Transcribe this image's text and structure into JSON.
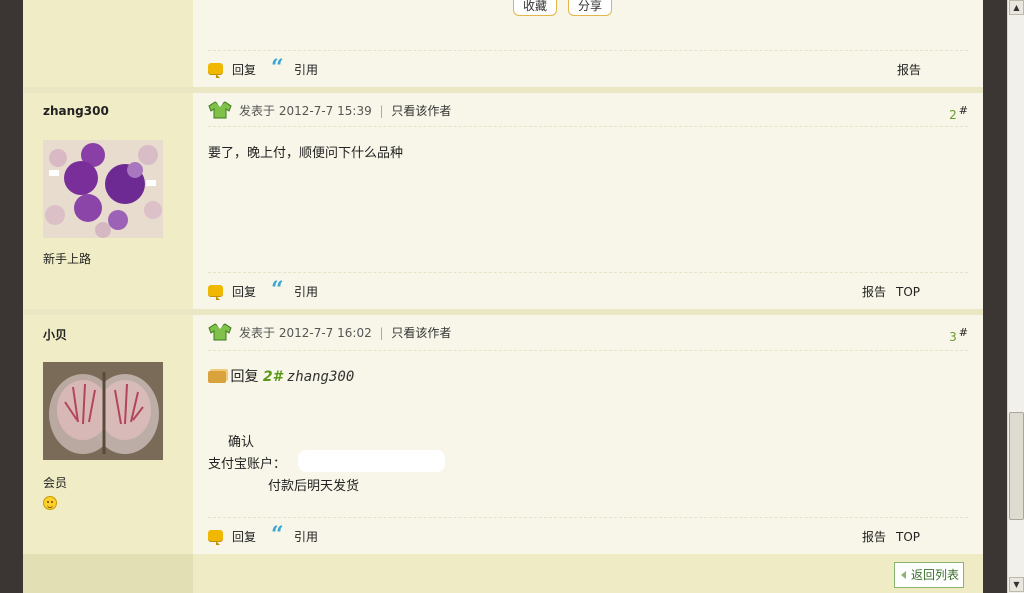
{
  "top_buttons": {
    "favorite": "收藏",
    "share": "分享"
  },
  "actions": {
    "reply": "回复",
    "quote": "引用",
    "report": "报告",
    "top": "TOP"
  },
  "posts": [
    {
      "username": "zhang300",
      "rank": "新手上路",
      "posted_label": "发表于",
      "posted_time": "2012-7-7 15:39",
      "only_author": "只看该作者",
      "floor": "2",
      "floor_suffix": "#",
      "content": "要了，晚上付，顺便问下什么品种"
    },
    {
      "username": "小贝",
      "rank": "会员",
      "posted_label": "发表于",
      "posted_time": "2012-7-7 16:02",
      "only_author": "只看该作者",
      "floor": "3",
      "floor_suffix": "#",
      "reply_label": "回复",
      "reply_floor": "2#",
      "reply_user": "zhang300",
      "line1": "确认",
      "line2": "支付宝账户：",
      "line3": "付款后明天发货"
    }
  ],
  "separator": "|",
  "back_to_list": "返回列表"
}
